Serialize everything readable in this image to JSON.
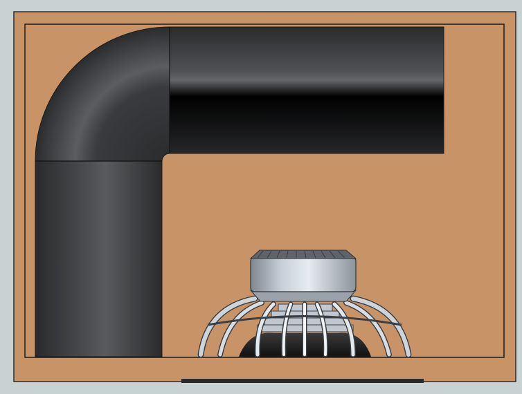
{
  "scene": {
    "subject": "subwoofer-enclosure-cross-section",
    "components": [
      {
        "id": "enclosure",
        "kind": "wood-box",
        "color": "#c89467"
      },
      {
        "id": "port-tube",
        "kind": "l-shaped-port",
        "segments": [
          "vertical-leg",
          "elbow",
          "horizontal-leg"
        ],
        "color": "#3a3b3d"
      },
      {
        "id": "woofer",
        "kind": "driver",
        "parts": [
          "magnet-motor",
          "basket-spokes",
          "cone"
        ],
        "color": "#a8b0b8"
      }
    ],
    "colors": {
      "background": "#c9d2d3",
      "wood": "#c89467",
      "outline": "#1b1b1b",
      "port": "#3a3b3d",
      "metal": "#a9b1b9"
    }
  }
}
